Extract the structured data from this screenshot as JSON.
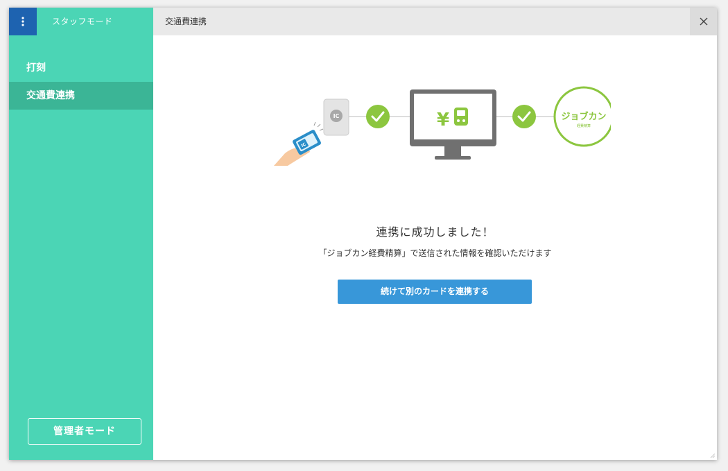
{
  "app": {
    "mode_label": "スタッフモード"
  },
  "sidebar": {
    "items": [
      {
        "label": "打刻",
        "active": false
      },
      {
        "label": "交通費連携",
        "active": true
      }
    ],
    "admin_button_label": "管理者モード"
  },
  "main": {
    "title": "交通費連携",
    "success_title": "連携に成功しました！",
    "success_description": "「ジョブカン経費精算」で送信された情報を確認いただけます",
    "continue_button_label": "続けて別のカードを連携する"
  },
  "illustration": {
    "reader_label": "IC",
    "card_label": "IC",
    "monitor_symbol": "¥",
    "brand_name": "ジョブカン",
    "brand_sub": "経費精算"
  },
  "colors": {
    "sidebar": "#4bd5b5",
    "sidebar_active": "#3bb596",
    "menu_button": "#1e63b0",
    "primary_button": "#3897d9",
    "check_green": "#8cc63f"
  }
}
